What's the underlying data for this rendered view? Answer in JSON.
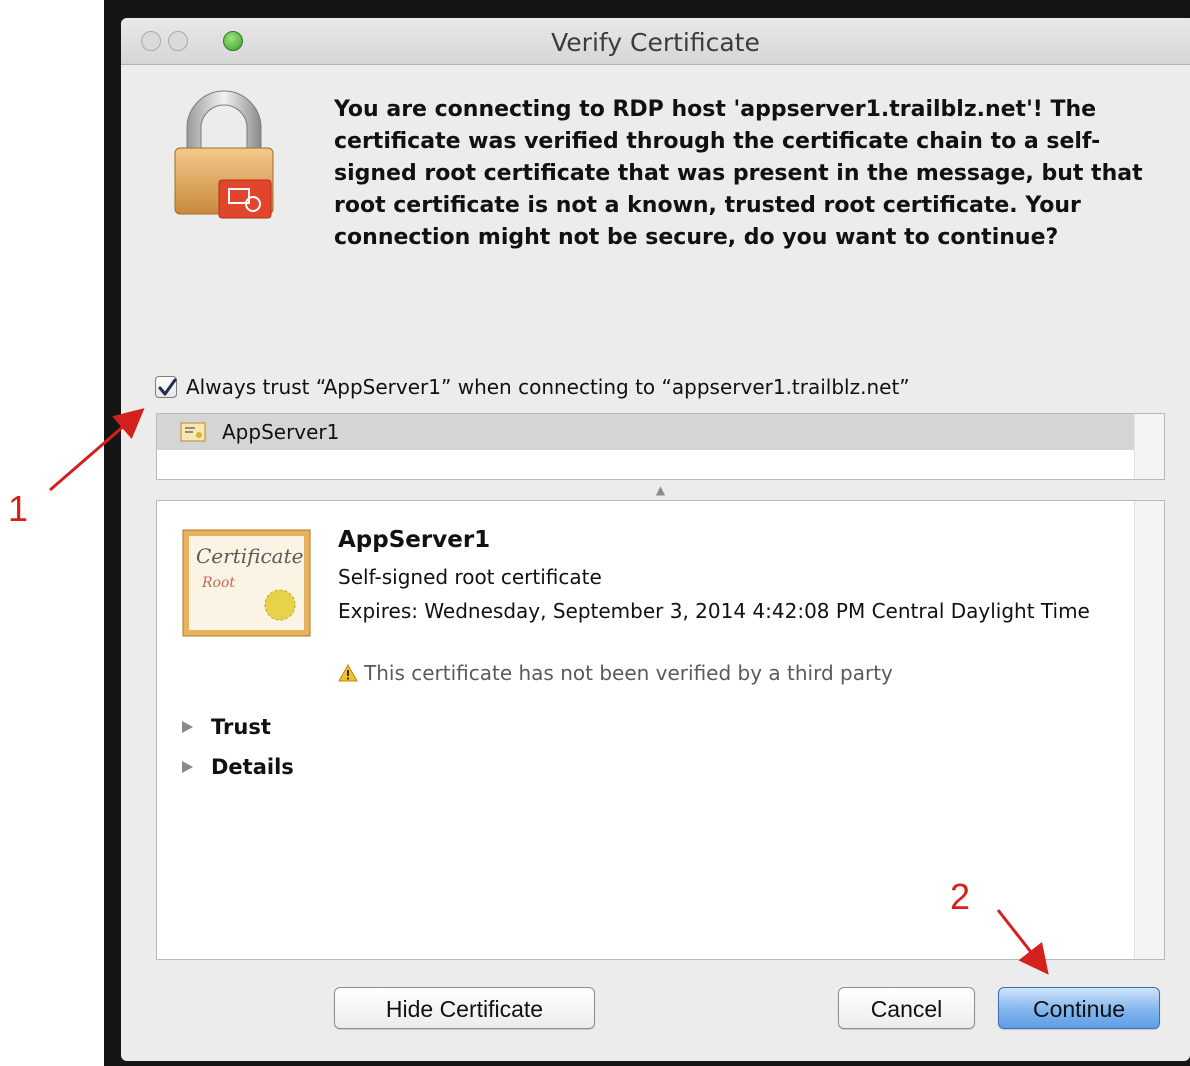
{
  "window": {
    "title": "Verify Certificate"
  },
  "message": "You are connecting to RDP host 'appserver1.trailblz.net'! The certificate was verified through the certificate chain to a self-signed root certificate that was present in the message, but that root certificate is not a known, trusted root certificate. Your connection might not be secure, do you want to continue?",
  "trust_checkbox": {
    "label": "Always trust “AppServer1” when connecting to “appserver1.trailblz.net”",
    "checked": true
  },
  "chain": {
    "items": [
      {
        "label": "AppServer1",
        "selected": true
      }
    ]
  },
  "certificate": {
    "name": "AppServer1",
    "type": "Self-signed root certificate",
    "expires": "Expires: Wednesday, September 3, 2014 4:42:08 PM Central Daylight Time",
    "warning": "This certificate has not been verified by a third party",
    "image_text": {
      "title": "Certificate",
      "subtitle": "Root"
    }
  },
  "sections": [
    {
      "label": "Trust",
      "expanded": false
    },
    {
      "label": "Details",
      "expanded": false
    }
  ],
  "buttons": {
    "hide_certificate": "Hide Certificate",
    "cancel": "Cancel",
    "continue": "Continue"
  },
  "annotations": {
    "step1": "1",
    "step2": "2"
  },
  "colors": {
    "annotation": "#d4211d",
    "default_button": "#6fa8ea",
    "window_bg": "#ececec"
  }
}
